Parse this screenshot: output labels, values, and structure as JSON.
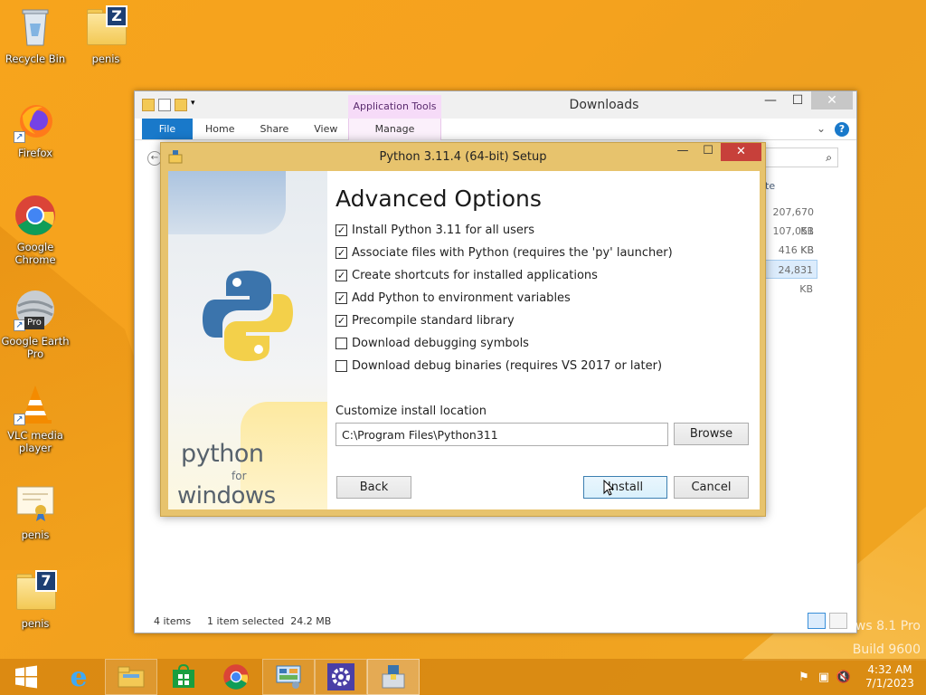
{
  "desktop": {
    "icons": [
      {
        "label": "Recycle Bin",
        "icon": "recycle-bin-icon"
      },
      {
        "label": "penis",
        "icon": "folder-z-icon"
      },
      {
        "label": "Firefox",
        "icon": "firefox-icon"
      },
      {
        "label": "Google Chrome",
        "icon": "chrome-icon"
      },
      {
        "label": "Google Earth Pro",
        "icon": "google-earth-icon"
      },
      {
        "label": "VLC media player",
        "icon": "vlc-icon"
      },
      {
        "label": "penis",
        "icon": "certificate-icon"
      },
      {
        "label": "penis",
        "icon": "folder-7-icon"
      }
    ],
    "badge_z": "Z",
    "badge_7": "7",
    "badge_pro": "Pro"
  },
  "explorer": {
    "title": "Downloads",
    "context_tab_header": "Application Tools",
    "tabs": [
      "File",
      "Home",
      "Share",
      "View",
      "Manage"
    ],
    "search_icon": "search-icon",
    "column_partial": "te",
    "sizes": [
      "207,670 KB",
      "107,051 KB",
      "416 KB",
      "24,831 KB"
    ],
    "selected_index": 3,
    "status_items": "4 items",
    "status_selected": "1 item selected  24.2 MB"
  },
  "setup": {
    "title": "Python 3.11.4 (64-bit) Setup",
    "heading": "Advanced Options",
    "options": [
      {
        "label": "Install Python 3.11 for all users",
        "checked": true
      },
      {
        "label": "Associate files with Python (requires the 'py' launcher)",
        "checked": true
      },
      {
        "label": "Create shortcuts for installed applications",
        "checked": true
      },
      {
        "label": "Add Python to environment variables",
        "checked": true
      },
      {
        "label": "Precompile standard library",
        "checked": true
      },
      {
        "label": "Download debugging symbols",
        "checked": false
      },
      {
        "label": "Download debug binaries (requires VS 2017 or later)",
        "checked": false
      }
    ],
    "location_label": "Customize install location",
    "location_value": "C:\\Program Files\\Python311",
    "browse_label": "Browse",
    "back_label": "Back",
    "install_label": "Install",
    "cancel_label": "Cancel",
    "brand_python": "python",
    "brand_for": "for",
    "brand_windows": "windows"
  },
  "taskbar": {
    "items": [
      "start-icon",
      "internet-explorer-icon",
      "file-explorer-icon",
      "store-icon",
      "chrome-icon",
      "control-panel-icon",
      "settings-icon",
      "python-installer-icon"
    ],
    "time": "4:32 AM",
    "date": "7/1/2023",
    "watermark_line1": "ows 8.1 Pro",
    "watermark_line2": "Build 9600"
  },
  "colors": {
    "accent": "#1979ca",
    "desktop": "#f5a21e",
    "setup_frame": "#e7c36d",
    "close_red": "#c7403a"
  }
}
